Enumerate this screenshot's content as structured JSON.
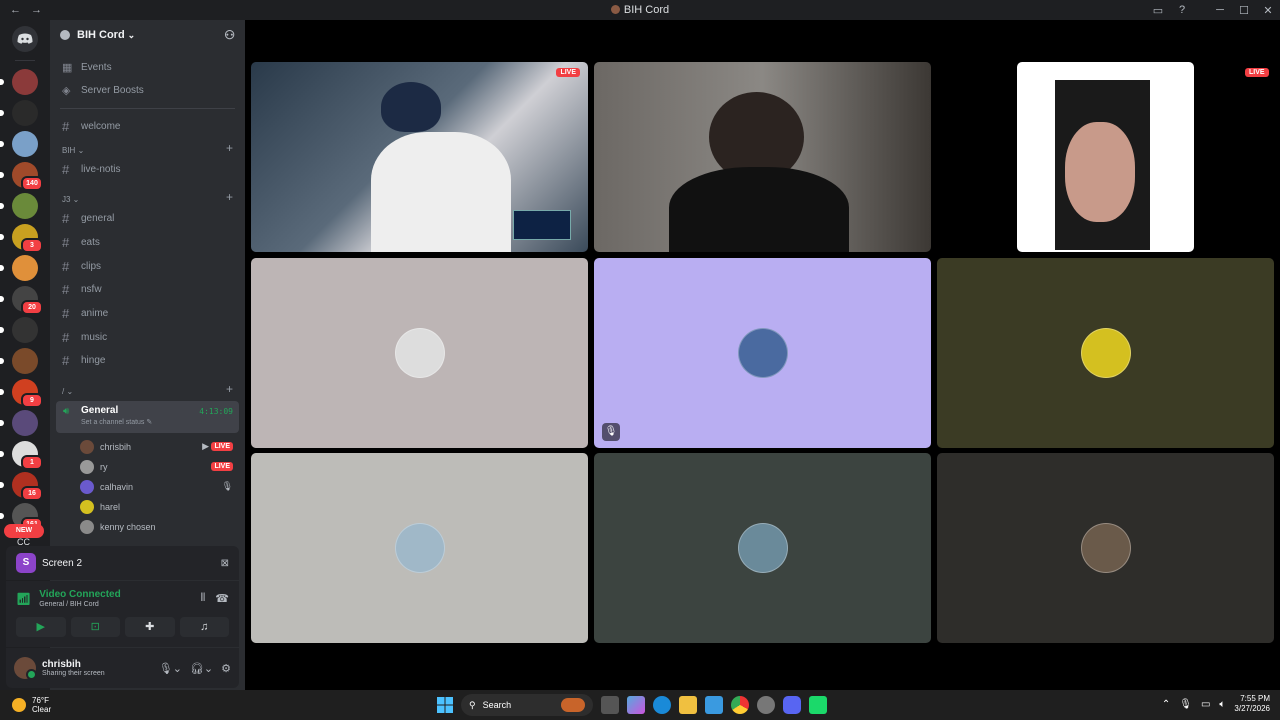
{
  "window": {
    "title": "BIH Cord",
    "nav_back": "←",
    "nav_fwd": "→",
    "inbox_icon": "▭",
    "help_icon": "?",
    "minimize": "─",
    "maximize": "☐",
    "close": "✕"
  },
  "servers": {
    "home_icon": "discord-logo",
    "items": [
      {
        "name": "server-1",
        "color": "#8b3a3a",
        "badge": ""
      },
      {
        "name": "server-2",
        "color": "#2a2a2a",
        "badge": ""
      },
      {
        "name": "server-3",
        "color": "#7aa0c8",
        "badge": ""
      },
      {
        "name": "server-4",
        "color": "#a04a2a",
        "badge": "140"
      },
      {
        "name": "server-5",
        "color": "#6a8a3a",
        "badge": ""
      },
      {
        "name": "server-6",
        "color": "#c8a020",
        "badge": "3"
      },
      {
        "name": "server-7",
        "color": "#e0903a",
        "badge": ""
      },
      {
        "name": "server-8",
        "color": "#444",
        "badge": "20"
      },
      {
        "name": "server-9",
        "color": "#333",
        "badge": ""
      },
      {
        "name": "server-10",
        "color": "#7a4a2a",
        "badge": ""
      },
      {
        "name": "server-11",
        "color": "#d04020",
        "badge": "9"
      },
      {
        "name": "server-12",
        "color": "#5a4a7a",
        "badge": ""
      },
      {
        "name": "server-13",
        "color": "#ddd",
        "badge": "1"
      },
      {
        "name": "server-14",
        "color": "#b03020",
        "badge": "16"
      },
      {
        "name": "server-15",
        "color": "#555",
        "badge": "161"
      }
    ],
    "new_label": "NEW",
    "cc_label": "CC"
  },
  "sidebar": {
    "guild_name": "BIH Cord",
    "events": "Events",
    "boosts": "Server Boosts",
    "welcome": "welcome",
    "cat1": "BIH",
    "live_notis": "live-notis",
    "cat2": "J3",
    "channels": [
      "general",
      "eats",
      "clips",
      "nsfw",
      "anime",
      "music",
      "hinge"
    ],
    "cat3": "/",
    "voice": {
      "name": "General",
      "time": "4:13:09",
      "status": "Set a channel status"
    },
    "voice_users": [
      {
        "name": "chrisbih",
        "color": "#6b4a3a"
      },
      {
        "name": "ry",
        "color": "#999"
      },
      {
        "name": "calhavin",
        "color": "#6a5acd"
      },
      {
        "name": "harel",
        "color": "#d4c020"
      },
      {
        "name": "kenny chosen",
        "color": "#8a8a8a"
      }
    ],
    "live_label": "LIVE"
  },
  "screen_panel": {
    "label": "Screen 2",
    "icon_letter": "S"
  },
  "vc_panel": {
    "title": "Video Connected",
    "subtitle": "General / BIH Cord"
  },
  "user_panel": {
    "name": "chrisbih",
    "status": "Sharing their screen"
  },
  "stage": {
    "live_label": "LIVE",
    "tiles": [
      {
        "name": "stream-baseball",
        "bg": "#3a4a5a"
      },
      {
        "name": "stream-webcam",
        "bg": "#4a4540"
      },
      {
        "name": "stream-browser",
        "bg": "#000"
      },
      {
        "name": "tile-user-4",
        "bg": "#bdb5b5"
      },
      {
        "name": "tile-user-5",
        "bg": "#b9aef2"
      },
      {
        "name": "tile-user-6",
        "bg": "#3b3b24"
      },
      {
        "name": "tile-user-7",
        "bg": "#bdbcb8"
      },
      {
        "name": "tile-user-8",
        "bg": "#3c4440"
      },
      {
        "name": "tile-user-9",
        "bg": "#2e2d2a"
      }
    ]
  },
  "taskbar": {
    "temp": "76°F",
    "condition": "Clear",
    "search": "Search",
    "time": "7:55 PM",
    "date": "3/27/2026"
  }
}
